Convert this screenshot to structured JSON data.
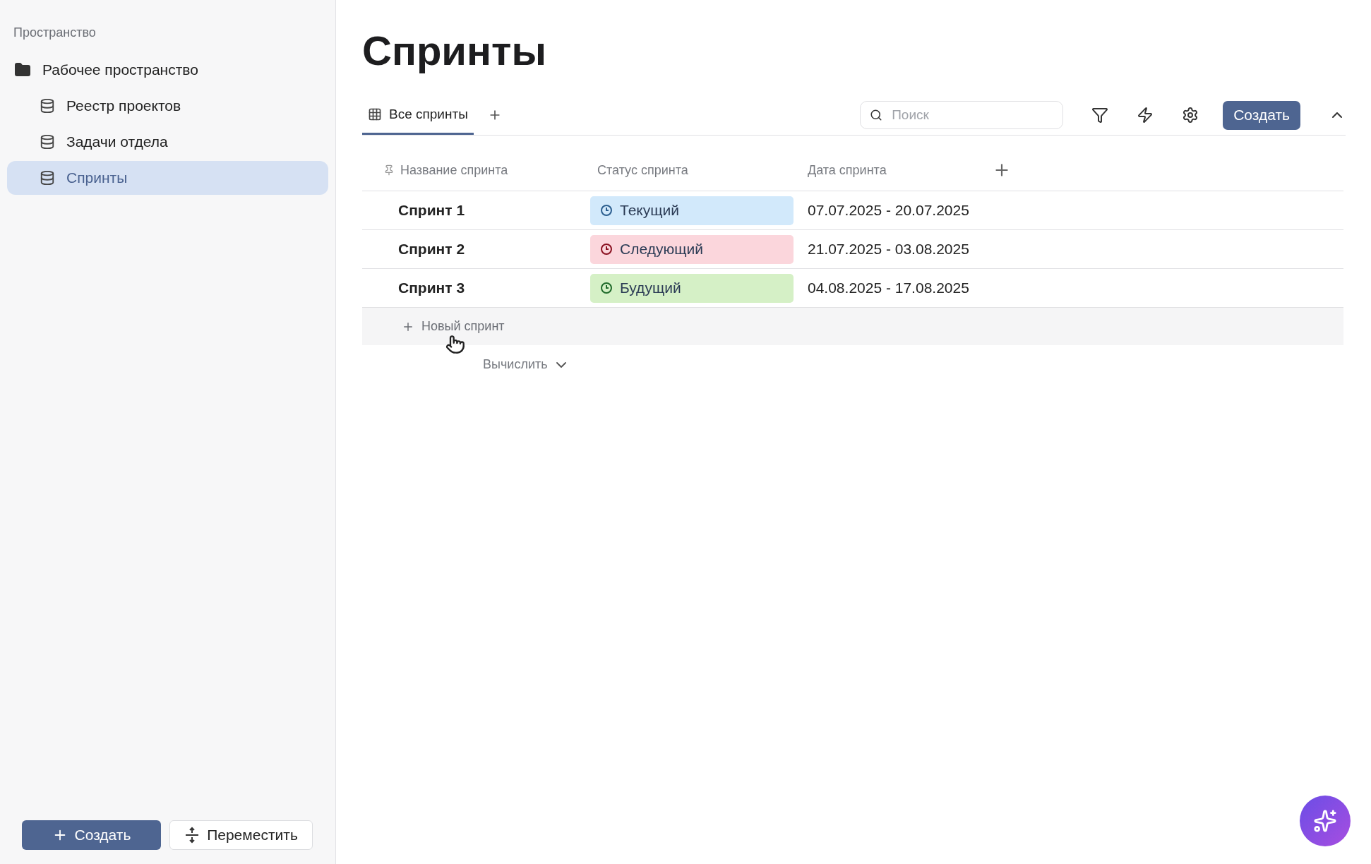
{
  "sidebar": {
    "section_title": "Пространство",
    "workspace": {
      "label": "Рабочее пространство",
      "children": [
        {
          "label": "Реестр проектов",
          "selected": false
        },
        {
          "label": "Задачи отдела",
          "selected": false
        },
        {
          "label": "Спринты",
          "selected": true
        }
      ]
    },
    "buttons": [
      {
        "kind": "primary",
        "label": "Создать"
      },
      {
        "kind": "move",
        "label": "Переместить"
      }
    ]
  },
  "page": {
    "title": "Спринты"
  },
  "tabs": [
    {
      "label": "Все спринты",
      "selected": true
    }
  ],
  "toolbar": {
    "search": {
      "placeholder": "Поиск"
    },
    "create_button": "Создать"
  },
  "table": {
    "columns": [
      "Название спринта",
      "Статус спринта",
      "Дата спринта"
    ],
    "rows": [
      {
        "name": "Спринт 1",
        "status": "Текущий",
        "color": "#d2e9fb",
        "date": "07.07.2025 - 20.07.2025"
      },
      {
        "name": "Спринт 2",
        "status": "Следующий",
        "color": "#fbd6dc",
        "date": "21.07.2025 - 03.08.2025"
      },
      {
        "name": "Спринт 3",
        "status": "Будущий",
        "color": "#d5f0c6",
        "date": "04.08.2025 - 17.08.2025"
      }
    ],
    "new_row": "Новый спринт",
    "calculate": "Вычислить"
  }
}
